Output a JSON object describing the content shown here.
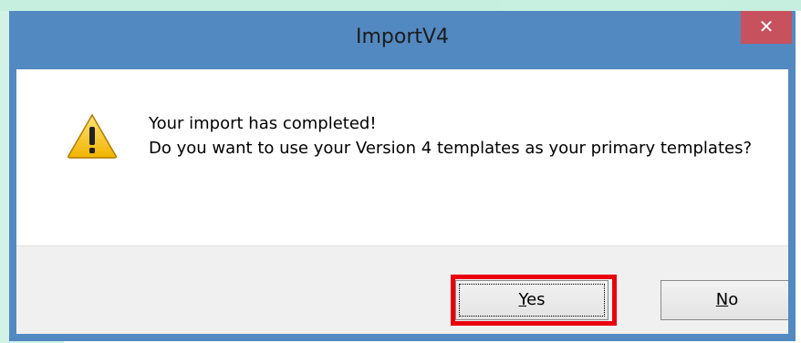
{
  "dialog": {
    "title": "ImportV4",
    "close_glyph": "✕",
    "icon": "warning-icon",
    "message_lines": [
      "Your import has completed!",
      "Do you want to use your Version 4 templates as your primary templates?"
    ],
    "buttons": {
      "yes": {
        "accel": "Y",
        "rest": "es"
      },
      "no": {
        "accel": "N",
        "rest": "o"
      }
    }
  },
  "colors": {
    "titlebar": "#5289c1",
    "close_button": "#c7515c",
    "highlight": "#e8000d"
  }
}
